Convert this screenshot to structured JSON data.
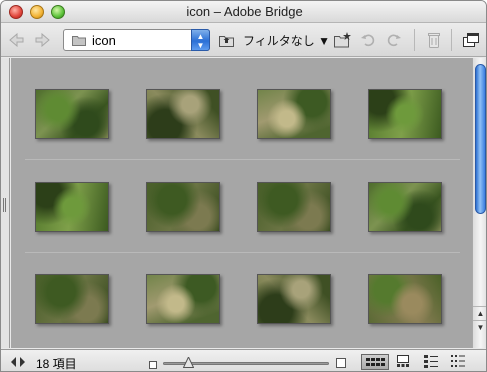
{
  "window": {
    "title": "icon – Adobe Bridge"
  },
  "toolbar": {
    "path_value": "icon",
    "filter_label": "フィルタなし ▼"
  },
  "content": {
    "thumbnails_visible": 12,
    "zoom_level": 0.15
  },
  "statusbar": {
    "item_count": "18 項目",
    "active_view": "thumbnails"
  },
  "colors": {
    "content_bg": "#a6a6a6",
    "accent": "#2a6fd6"
  },
  "icons": [
    "back-icon",
    "forward-icon",
    "folder-icon",
    "up-folder-icon",
    "new-folder-icon",
    "rotate-left-icon",
    "rotate-right-icon",
    "trash-icon",
    "compact-mode-icon"
  ]
}
